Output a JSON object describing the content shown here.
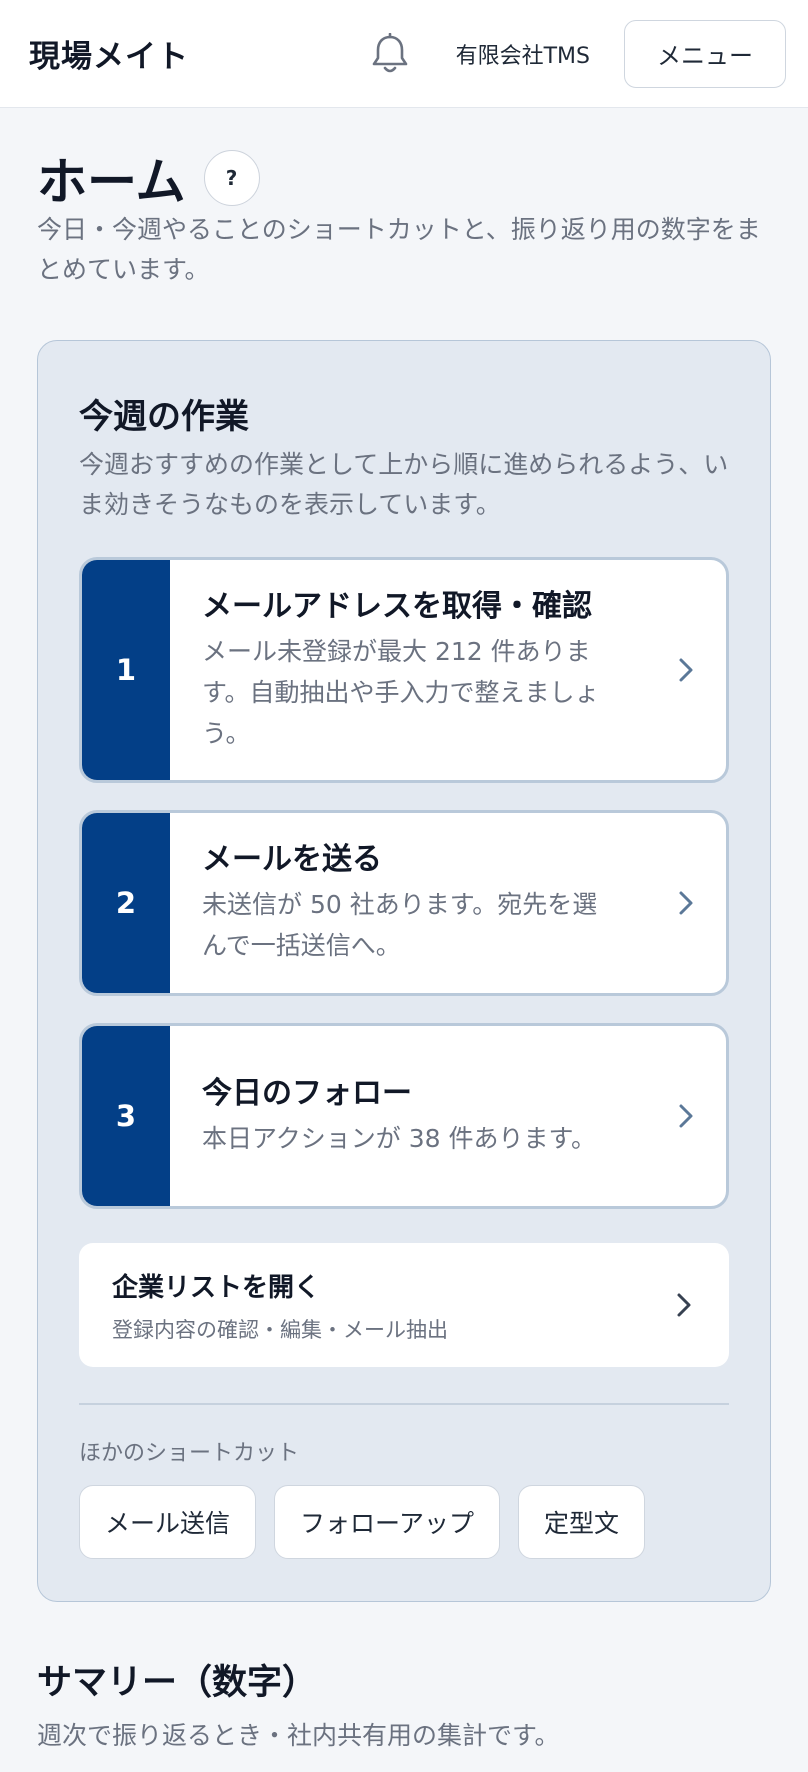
{
  "header": {
    "app_name": "現場メイト",
    "company": "有限会社TMS",
    "menu_label": "メニュー",
    "bell_icon": "bell-icon"
  },
  "page": {
    "title": "ホーム",
    "help_label": "?",
    "description": "今日・今週やることのショートカットと、振り返り用の数字をまとめています。"
  },
  "weekly": {
    "title": "今週の作業",
    "description": "今週おすすめの作業として上から順に進められるよう、いま効きそうなものを表示しています。",
    "tasks": [
      {
        "number": "1",
        "title": "メールアドレスを取得・確認",
        "description": "メール未登録が最大 212 件あります。自動抽出や手入力で整えましょう。"
      },
      {
        "number": "2",
        "title": "メールを送る",
        "description": "未送信が 50 社あります。宛先を選んで一括送信へ。"
      },
      {
        "number": "3",
        "title": "今日のフォロー",
        "description": "本日アクションが 38 件あります。"
      }
    ],
    "list_link": {
      "title": "企業リストを開く",
      "subtitle": "登録内容の確認・編集・メール抽出"
    },
    "other_label": "ほかのショートカット",
    "shortcuts": [
      "メール送信",
      "フォローアップ",
      "定型文"
    ]
  },
  "summary": {
    "title": "サマリー（数字）",
    "description": "週次で振り返るとき・社内共有用の集計です。"
  },
  "colors": {
    "accent": "#033f87",
    "panel_bg": "#e3e9f1",
    "panel_border": "#b6c6d8",
    "muted_text": "#6b7280",
    "chevron": "#5b7898"
  }
}
